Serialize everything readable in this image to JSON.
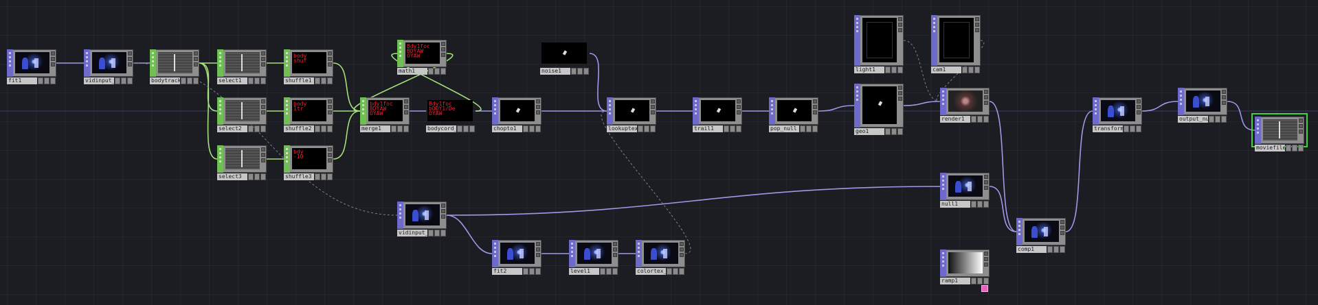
{
  "network": {
    "nodes": [
      {
        "id": "fit1",
        "label": "fit1",
        "type": "top",
        "thumb": "video"
      },
      {
        "id": "vidinput_null",
        "label": "vidinput_null",
        "type": "top",
        "thumb": "video"
      },
      {
        "id": "bodytrack1",
        "label": "bodytrack1",
        "type": "chop",
        "thumb": "gray"
      },
      {
        "id": "select1",
        "label": "select1",
        "type": "chop",
        "thumb": "gray"
      },
      {
        "id": "shuffle1",
        "label": "shuffle1",
        "type": "chop",
        "thumb": "text",
        "thumb_text": "body\nshuf"
      },
      {
        "id": "math1",
        "label": "math1",
        "type": "chop",
        "thumb": "text",
        "thumb_text": "Bdy1foc\nBDYAW\nOYAW"
      },
      {
        "id": "select2",
        "label": "select2",
        "type": "chop",
        "thumb": "gray"
      },
      {
        "id": "shuffle2",
        "label": "shuffle2",
        "type": "chop",
        "thumb": "text",
        "thumb_text": "body\n1tr"
      },
      {
        "id": "merge1",
        "label": "merge1",
        "type": "chop",
        "thumb": "text",
        "thumb_text": "bdy1foc\nBDYAW\nOYAW"
      },
      {
        "id": "bodycord_null",
        "label": "bodycord_null",
        "type": "none",
        "thumb": "text",
        "thumb_text": "Bdy1foc\nbDDY1/De\nOYAW"
      },
      {
        "id": "select3",
        "label": "select3",
        "type": "chop",
        "thumb": "gray"
      },
      {
        "id": "shuffle3",
        "label": "shuffle3",
        "type": "chop",
        "thumb": "text",
        "thumb_text": "bdy\n-10"
      },
      {
        "id": "chopto1",
        "label": "chopto1",
        "type": "top",
        "thumb": "dark"
      },
      {
        "id": "noise1",
        "label": "noise1",
        "type": "none",
        "thumb": "dark"
      },
      {
        "id": "lookup_tex1",
        "label": "lookuptex1",
        "type": "top",
        "thumb": "dark"
      },
      {
        "id": "trail1",
        "label": "trail1",
        "type": "top",
        "thumb": "dark"
      },
      {
        "id": "pop_null",
        "label": "pop_null",
        "type": "top",
        "thumb": "dark"
      },
      {
        "id": "light1",
        "label": "light1",
        "type": "comp",
        "thumb": "black"
      },
      {
        "id": "cam1",
        "label": "cam1",
        "type": "comp",
        "thumb": "black"
      },
      {
        "id": "geo1",
        "label": "geo1",
        "type": "comp",
        "thumb": "dark"
      },
      {
        "id": "render1",
        "label": "render1",
        "type": "top",
        "thumb": "render"
      },
      {
        "id": "vidinput_select",
        "label": "vidinput_select",
        "type": "top",
        "thumb": "video"
      },
      {
        "id": "null1",
        "label": "null1",
        "type": "top",
        "thumb": "video"
      },
      {
        "id": "comp1",
        "label": "comp1",
        "type": "top",
        "thumb": "video"
      },
      {
        "id": "transform1",
        "label": "transform1",
        "type": "top",
        "thumb": "video"
      },
      {
        "id": "output_null",
        "label": "output_null",
        "type": "top",
        "thumb": "video"
      },
      {
        "id": "moviefileout1",
        "label": "moviefileout1",
        "type": "top",
        "thumb": "gray"
      },
      {
        "id": "fit2",
        "label": "fit2",
        "type": "top",
        "thumb": "video"
      },
      {
        "id": "level1",
        "label": "level1",
        "type": "top",
        "thumb": "video"
      },
      {
        "id": "colortex_null",
        "label": "colortex_null",
        "type": "top",
        "thumb": "video"
      },
      {
        "id": "ramp1",
        "label": "ramp1",
        "type": "top",
        "thumb": "ramp"
      }
    ],
    "colors": {
      "background": "#1b1d22",
      "top_family": "#6e6acb",
      "chop_family": "#6fbf55",
      "top_wire": "#9e9ae8",
      "chop_wire": "#a6e07c",
      "selection": "#3fd13f",
      "dependency": "#7a8296"
    }
  }
}
